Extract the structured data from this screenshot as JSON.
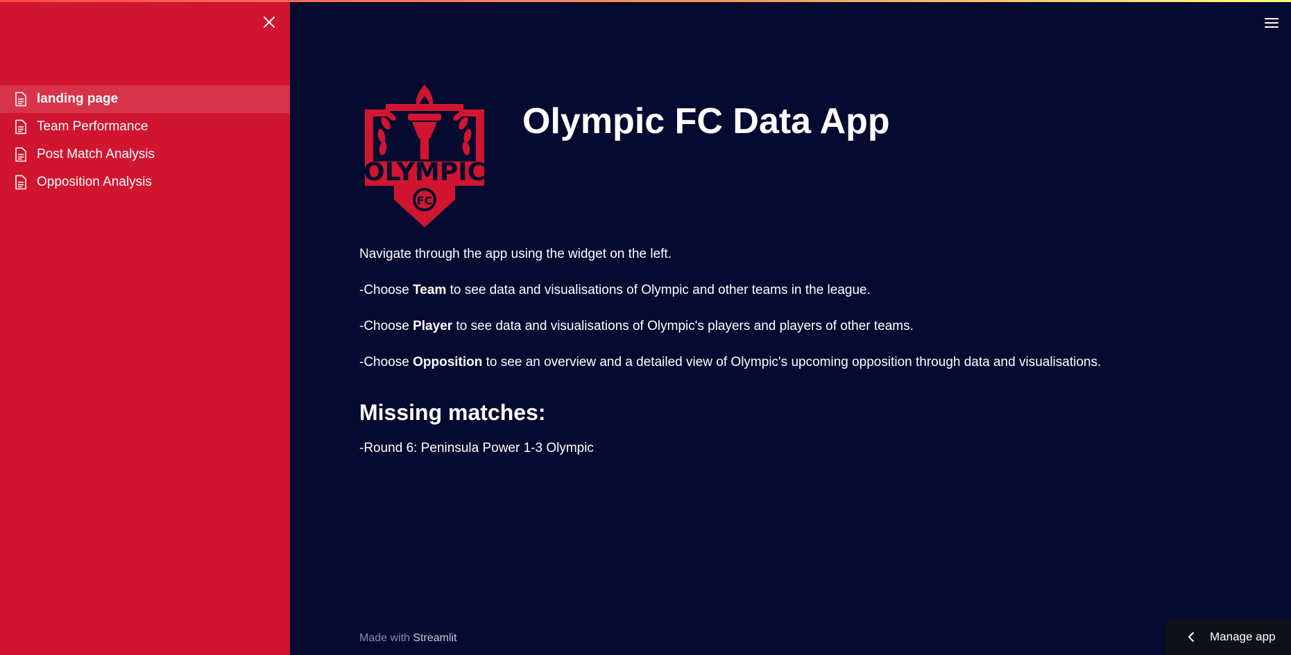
{
  "app": {
    "title": "Olympic FC Data App"
  },
  "sidebar": {
    "items": [
      {
        "label": "landing page",
        "active": true
      },
      {
        "label": "Team Performance",
        "active": false
      },
      {
        "label": "Post Match Analysis",
        "active": false
      },
      {
        "label": "Opposition Analysis",
        "active": false
      }
    ]
  },
  "logo": {
    "text": "OLYMPIC",
    "subtext": "FC",
    "color": "#d11530"
  },
  "content": {
    "intro": "Navigate through the app using the widget on the left.",
    "team_prefix": "-Choose ",
    "team_bold": "Team",
    "team_rest": " to see data and visualisations of Olympic and other teams in the league.",
    "player_prefix": "-Choose ",
    "player_bold": "Player",
    "player_rest": " to see data and visualisations of Olympic's players and players of other teams.",
    "opp_prefix": "-Choose ",
    "opp_bold": "Opposition",
    "opp_rest": " to see an overview and a detailed view of Olympic's upcoming opposition through data and visualisations.",
    "missing_heading": "Missing matches:",
    "missing_item": "-Round 6: Peninsula Power 1-3 Olympic"
  },
  "footer": {
    "prefix": "Made with ",
    "brand": "Streamlit"
  },
  "manage": {
    "label": "Manage app"
  },
  "colors": {
    "sidebar_bg": "#d11530",
    "main_bg": "#050a30"
  }
}
